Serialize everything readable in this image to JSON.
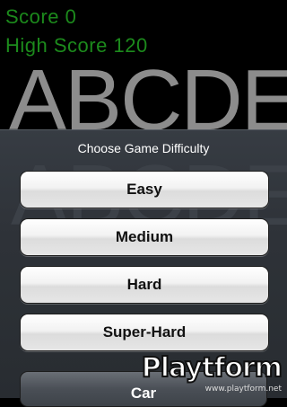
{
  "game": {
    "score_label": "Score",
    "score_value": "0",
    "high_score_label": "High Score",
    "high_score_value": "120",
    "letters": "ABCDE"
  },
  "dialog": {
    "title": "Choose Game Difficulty",
    "options": [
      "Easy",
      "Medium",
      "Hard",
      "Super-Hard"
    ],
    "cancel_label": "Car"
  },
  "watermark": {
    "logo": "Playtform",
    "url": "www.playtform.net"
  }
}
